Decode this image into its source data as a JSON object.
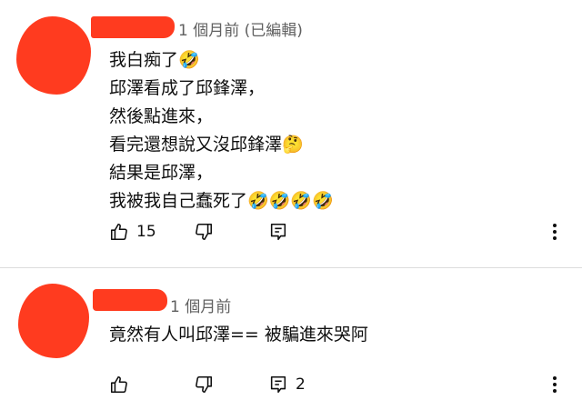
{
  "colors": {
    "redaction": "#ff3b1f",
    "text": "#0f0f0f",
    "meta": "#606060"
  },
  "comments": [
    {
      "time": "1 個月前 (已編輯)",
      "lines": [
        "我白痴了🤣",
        "邱澤看成了邱鋒澤，",
        "然後點進來，",
        "看完還想說又沒邱鋒澤🤔",
        "結果是邱澤，",
        "我被我自己蠢死了🤣🤣🤣🤣"
      ],
      "like_count": "15",
      "reply_count": ""
    },
    {
      "time": "1 個月前",
      "lines": [
        "竟然有人叫邱澤== 被騙進來哭阿"
      ],
      "like_count": "",
      "reply_count": "2"
    }
  ],
  "icons": {
    "like": "thumb-up-icon",
    "dislike": "thumb-down-icon",
    "reply": "reply-icon",
    "menu": "more-vert-icon"
  }
}
